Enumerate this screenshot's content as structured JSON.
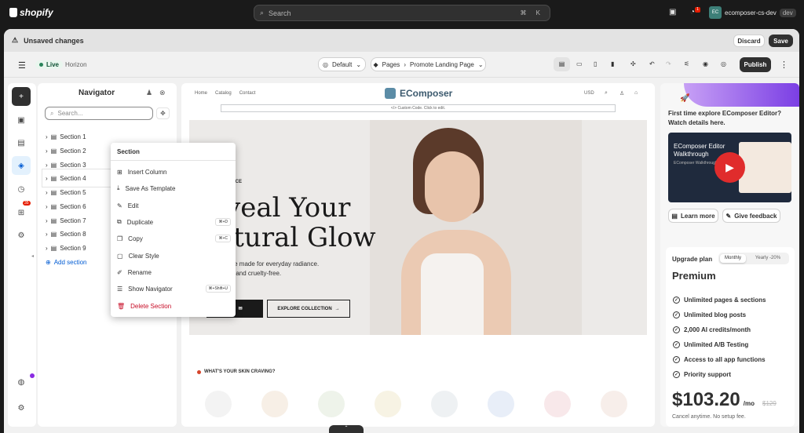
{
  "topbar": {
    "logo_text": "shopify",
    "search_placeholder": "Search",
    "search_shortcut": "⌘ K",
    "notif_count": "1",
    "account_initials": "EC",
    "account_name": "ecomposer-cs-dev",
    "account_tag": "dev"
  },
  "unsaved": {
    "title": "Unsaved changes",
    "discard": "Discard",
    "save": "Save"
  },
  "editor": {
    "live": "Live",
    "theme": "Horizon",
    "device": "Default",
    "pages": "Pages",
    "page_name": "Promote Landing Page",
    "publish": "Publish"
  },
  "rail": {
    "badge": "35"
  },
  "navigator": {
    "title": "Navigator",
    "search_placeholder": "Search...",
    "sections": [
      "Section 1",
      "Section 2",
      "Section 3",
      "Section 4",
      "Section 5",
      "Section 6",
      "Section 7",
      "Section 8",
      "Section 9"
    ],
    "add_section": "Add section"
  },
  "context_menu": {
    "title": "Section",
    "items": [
      {
        "label": "Insert Column",
        "icon": "insert-column-icon",
        "shortcut": ""
      },
      {
        "label": "Save As Template",
        "icon": "save-template-icon",
        "shortcut": ""
      },
      {
        "label": "Edit",
        "icon": "edit-icon",
        "shortcut": ""
      },
      {
        "label": "Duplicate",
        "icon": "duplicate-icon",
        "shortcut": "⌘+D"
      },
      {
        "label": "Copy",
        "icon": "copy-icon",
        "shortcut": "⌘+C"
      },
      {
        "label": "Clear Style",
        "icon": "clear-style-icon",
        "shortcut": ""
      },
      {
        "label": "Rename",
        "icon": "rename-icon",
        "shortcut": ""
      },
      {
        "label": "Show Navigator",
        "icon": "list-icon",
        "shortcut": "⌘+Shift+U"
      },
      {
        "label": "Delete Section",
        "icon": "trash-icon",
        "shortcut": ""
      }
    ]
  },
  "preview": {
    "nav_links": [
      "Home",
      "Catalog",
      "Contact"
    ],
    "brand": "EComposer",
    "currency": "USD",
    "custom_code": "Custom Code. Click to edit.",
    "hero_kicker": "ANCE",
    "hero_line1": "veal Your",
    "hero_line2": "atural Glow",
    "hero_sub1": "care made for everyday radiance.",
    "hero_sub2": "an, and cruelty-free.",
    "cta1": "OW",
    "cta2": "EXPLORE COLLECTION",
    "craving": "WHAT'S YOUR SKIN CRAVING?"
  },
  "right": {
    "promo": "First time explore EComposer Editor? Watch details here.",
    "video_title": "EComposer Editor Walkthrough",
    "video_sub": "EComposer Walkthrough",
    "learn_more": "Learn more",
    "give_feedback": "Give feedback",
    "upgrade": "Upgrade plan",
    "monthly": "Monthly",
    "yearly": "Yearly -20%",
    "plan": "Premium",
    "features": [
      "Unlimited pages & sections",
      "Unlimited blog posts",
      "2,000 AI credits/month",
      "Unlimited A/B Testing",
      "Access to all app functions",
      "Priority support"
    ],
    "price": "$103.20",
    "per": "/mo",
    "old_price": "$129",
    "cancel": "Cancel anytime. No setup fee."
  }
}
